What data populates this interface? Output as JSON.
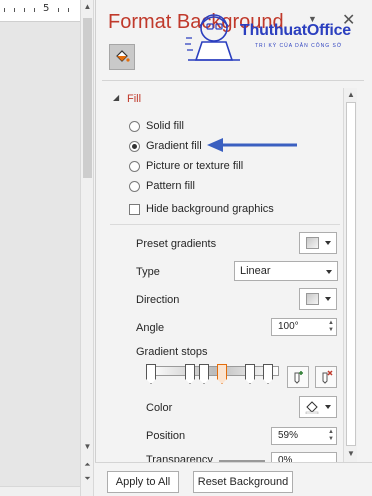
{
  "ruler": {
    "number": "5"
  },
  "pane": {
    "title": "Format Background",
    "menu_glyph": "▼",
    "close_glyph": "✕",
    "fill_tab_icon": "paint-bucket-icon"
  },
  "watermark": {
    "brand": "ThuthuatOffice",
    "tagline": "TRI KỲ CỦA DÂN CÔNG SỞ"
  },
  "fill": {
    "section_label": "Fill",
    "options": [
      {
        "label": "Solid fill",
        "checked": false
      },
      {
        "label": "Gradient fill",
        "checked": true
      },
      {
        "label": "Picture or texture fill",
        "checked": false
      },
      {
        "label": "Pattern fill",
        "checked": false
      }
    ],
    "hide_bg_label": "Hide background graphics",
    "preset_label": "Preset gradients",
    "type_label": "Type",
    "type_value": "Linear",
    "direction_label": "Direction",
    "angle_label": "Angle",
    "angle_value": "100°",
    "stops_label": "Gradient stops",
    "color_label": "Color",
    "position_label": "Position",
    "position_value": "59%",
    "transparency_label": "Transparency",
    "transparency_value": "0%"
  },
  "footer": {
    "apply_all": "Apply to All",
    "reset": "Reset Background"
  },
  "colors": {
    "accent": "#c0392b",
    "arrow": "#3a5fc0",
    "logo": "#2b3fbf",
    "selected_stop": "#e46c0a"
  }
}
